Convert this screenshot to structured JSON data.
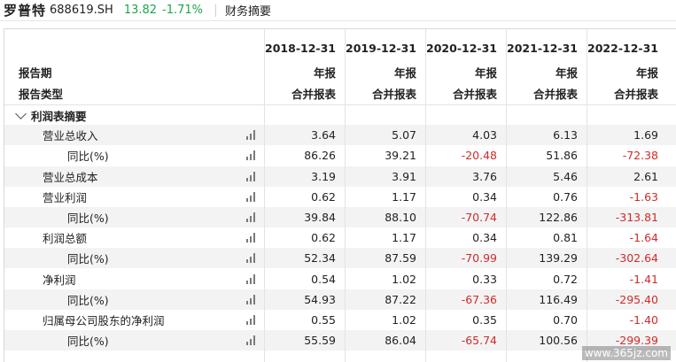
{
  "header": {
    "stock_name": "罗普特",
    "stock_code": "688619.SH",
    "price": "13.82",
    "change": "-1.71%",
    "section": "财务摘要"
  },
  "table": {
    "col_label_period": "报告期",
    "col_label_type": "报告类型",
    "periods": [
      "2018-12-31",
      "2019-12-31",
      "2020-12-31",
      "2021-12-31",
      "2022-12-31"
    ],
    "report_kind": [
      "年报",
      "年报",
      "年报",
      "年报",
      "年报"
    ],
    "report_type": [
      "合并报表",
      "合并报表",
      "合并报表",
      "合并报表",
      "合并报表"
    ],
    "group_label": "利润表摘要",
    "rows": [
      {
        "label": "营业总收入",
        "indent": 1,
        "values": [
          "3.64",
          "5.07",
          "4.03",
          "6.13",
          "1.69"
        ]
      },
      {
        "label": "同比(%)",
        "indent": 2,
        "values": [
          "86.26",
          "39.21",
          "-20.48",
          "51.86",
          "-72.38"
        ]
      },
      {
        "label": "营业总成本",
        "indent": 1,
        "values": [
          "3.19",
          "3.91",
          "3.76",
          "5.46",
          "2.61"
        ]
      },
      {
        "label": "营业利润",
        "indent": 1,
        "values": [
          "0.62",
          "1.17",
          "0.34",
          "0.76",
          "-1.63"
        ]
      },
      {
        "label": "同比(%)",
        "indent": 2,
        "values": [
          "39.84",
          "88.10",
          "-70.74",
          "122.86",
          "-313.81"
        ]
      },
      {
        "label": "利润总额",
        "indent": 1,
        "values": [
          "0.62",
          "1.17",
          "0.34",
          "0.81",
          "-1.64"
        ]
      },
      {
        "label": "同比(%)",
        "indent": 2,
        "values": [
          "52.34",
          "87.59",
          "-70.99",
          "139.29",
          "-302.64"
        ]
      },
      {
        "label": "净利润",
        "indent": 1,
        "values": [
          "0.54",
          "1.02",
          "0.33",
          "0.72",
          "-1.41"
        ]
      },
      {
        "label": "同比(%)",
        "indent": 2,
        "values": [
          "54.93",
          "87.22",
          "-67.36",
          "116.49",
          "-295.40"
        ]
      },
      {
        "label": "归属母公司股东的净利润",
        "indent": 1,
        "values": [
          "0.55",
          "1.02",
          "0.35",
          "0.70",
          "-1.40"
        ]
      },
      {
        "label": "同比(%)",
        "indent": 2,
        "values": [
          "55.59",
          "86.04",
          "-65.74",
          "100.56",
          "-299.39"
        ]
      }
    ]
  },
  "watermark": "www.365jz.com",
  "colors": {
    "up": "#1aa64a",
    "negative": "#d22a2a",
    "shade": "#f3f3f3"
  }
}
